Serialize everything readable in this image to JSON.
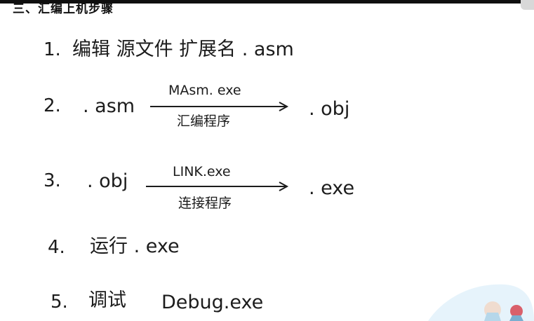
{
  "heading": "三、汇编上机步骤",
  "steps": [
    {
      "number": "1.",
      "text": "编辑 源文件 扩展名 . asm"
    },
    {
      "number": "2.",
      "source": ". asm",
      "tool": "MAsm. exe",
      "tool_desc": "汇编程序",
      "result": ". obj"
    },
    {
      "number": "3.",
      "source": ". obj",
      "tool": "LINK.exe",
      "tool_desc": "连接程序",
      "result": ". exe"
    },
    {
      "number": "4.",
      "text": "运行 . exe"
    },
    {
      "number": "5.",
      "text": "调试",
      "file": "Debug.exe"
    }
  ],
  "colors": {
    "ink": "#1c1c1c",
    "accent_blob": "#e6f3fb"
  }
}
